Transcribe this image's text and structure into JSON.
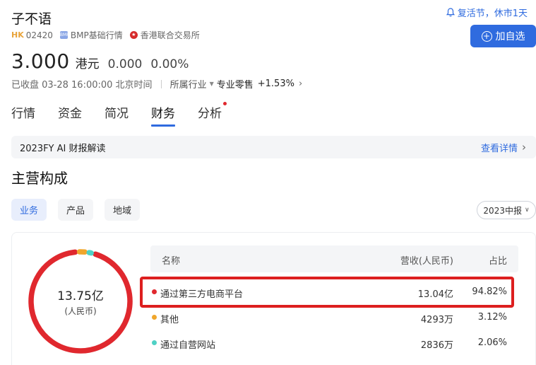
{
  "stock": {
    "name": "子不语",
    "market": "HK",
    "code": "02420",
    "data_source": "BMP基础行情",
    "exchange": "香港联合交易所",
    "price": "3.000",
    "currency": "港元",
    "change": "0.000",
    "change_pct": "0.00%",
    "status": "已收盘 03-28 16:00:00 北京时间",
    "industry_label": "所属行业",
    "industry_name": "专业零售",
    "industry_change": "+1.53%"
  },
  "notice": "复活节，休市1天",
  "add_watchlist_label": "加自选",
  "tabs": [
    {
      "label": "行情"
    },
    {
      "label": "资金"
    },
    {
      "label": "简况"
    },
    {
      "label": "财务",
      "active": true
    },
    {
      "label": "分析",
      "has_dot": true
    }
  ],
  "ai_banner": {
    "text": "2023FY AI 财报解读",
    "link": "查看详情"
  },
  "section_title": "主营构成",
  "chips": [
    {
      "label": "业务",
      "active": true
    },
    {
      "label": "产品"
    },
    {
      "label": "地域"
    }
  ],
  "period": "2023中报",
  "donut": {
    "total": "13.75亿",
    "unit": "(人民币)"
  },
  "table": {
    "headers": {
      "name": "名称",
      "revenue": "营收(人民币)",
      "share": "占比"
    },
    "rows": [
      {
        "name": "通过第三方电商平台",
        "revenue": "13.04亿",
        "share": "94.82%",
        "share_value": 94.82,
        "color": "#e0282e"
      },
      {
        "name": "其他",
        "revenue": "4293万",
        "share": "3.12%",
        "share_value": 3.12,
        "color": "#f0a62c"
      },
      {
        "name": "通过自营网站",
        "revenue": "2836万",
        "share": "2.06%",
        "share_value": 2.06,
        "color": "#4fd1c5"
      }
    ]
  },
  "colors": {
    "accent": "#2f6bdf",
    "highlight_box": "#dd1f1f"
  }
}
